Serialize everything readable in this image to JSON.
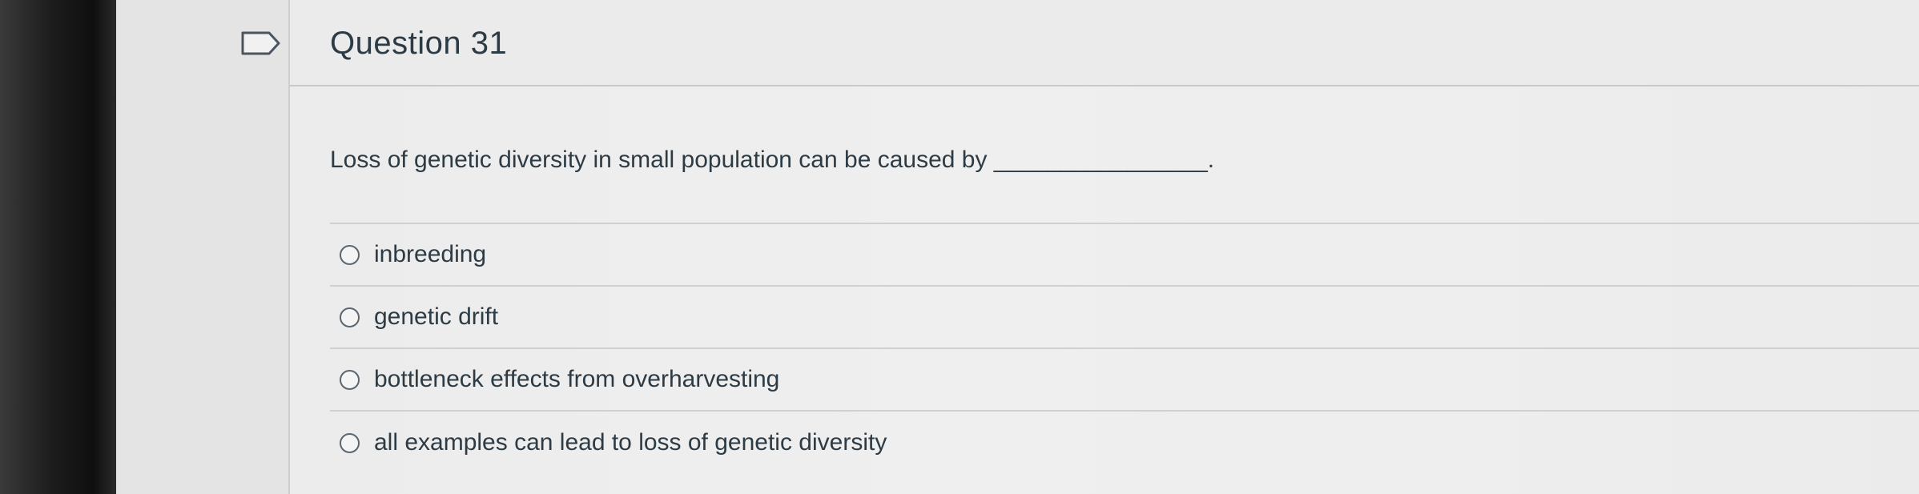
{
  "question": {
    "title": "Question 31",
    "prompt": "Loss of genetic diversity in small population can be caused by ________________.",
    "answers": [
      {
        "label": "inbreeding"
      },
      {
        "label": "genetic drift"
      },
      {
        "label": "bottleneck effects from overharvesting"
      },
      {
        "label": "all examples can lead to loss of genetic diversity"
      }
    ]
  },
  "icons": {
    "flag": "flag-outline-icon",
    "radio": "radio-unselected-icon"
  },
  "colors": {
    "text": "#2d3b45",
    "divider": "#d0d0d0",
    "background": "#ececec"
  }
}
